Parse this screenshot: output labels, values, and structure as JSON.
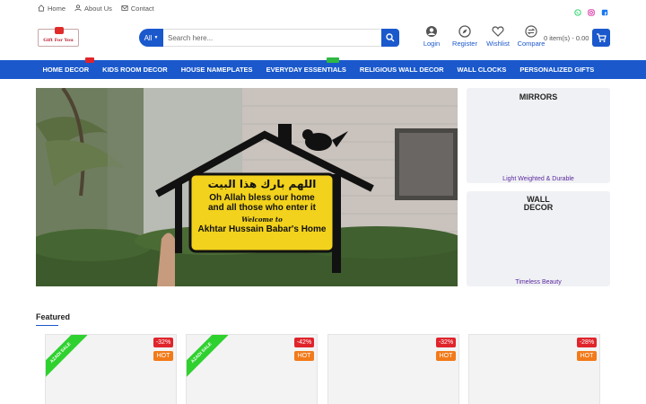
{
  "topbar": {
    "links": [
      {
        "label": "Home",
        "icon": "home-icon"
      },
      {
        "label": "About Us",
        "icon": "people-icon"
      },
      {
        "label": "Contact",
        "icon": "mail-icon"
      }
    ],
    "socials": [
      "whatsapp-icon",
      "instagram-icon",
      "facebook-icon"
    ]
  },
  "header": {
    "logo_text": "Gift For You",
    "search": {
      "category": "All",
      "placeholder": "Search here..."
    },
    "actions": [
      {
        "label": "Login",
        "icon": "user-icon"
      },
      {
        "label": "Register",
        "icon": "compass-icon"
      },
      {
        "label": "Wishlist",
        "icon": "heart-icon"
      },
      {
        "label": "Compare",
        "icon": "compare-icon"
      }
    ],
    "cart_text": "0 item(s) - 0.00"
  },
  "nav": {
    "items": [
      {
        "label": "HOME DECOR",
        "badge": "hot"
      },
      {
        "label": "KIDS ROOM DECOR"
      },
      {
        "label": "HOUSE NAMEPLATES"
      },
      {
        "label": "EVERYDAY ESSENTIALS",
        "badge": "new"
      },
      {
        "label": "RELIGIOUS WALL DECOR"
      },
      {
        "label": "WALL CLOCKS"
      },
      {
        "label": "PERSONALIZED GIFTS"
      }
    ]
  },
  "hero": {
    "arabic": "اللهم بارك هذا البيت",
    "line1": "Oh Allah bless our home",
    "line2": "and all those who enter it",
    "line3": "Welcome to",
    "line4": "Akhtar Hussain Babar's Home"
  },
  "side_banners": [
    {
      "title": "MIRRORS",
      "subtitle": "Light Weighted & Durable"
    },
    {
      "title": "WALL DECOR",
      "subtitle": "Timeless Beauty"
    }
  ],
  "featured": {
    "title": "Featured",
    "products": [
      {
        "discount": "-32%",
        "hot": "HOT",
        "ribbon": "AZADI SALE"
      },
      {
        "discount": "-42%",
        "hot": "HOT",
        "ribbon": "AZADI SALE"
      },
      {
        "discount": "-32%",
        "hot": "HOT",
        "ribbon": ""
      },
      {
        "discount": "-28%",
        "hot": "HOT",
        "ribbon": ""
      }
    ]
  },
  "colors": {
    "primary": "#1a58cc",
    "nav_bg": "#1a58cc",
    "discount": "#e0242b",
    "hot": "#f27a1a",
    "ribbon": "#2fd12f"
  }
}
